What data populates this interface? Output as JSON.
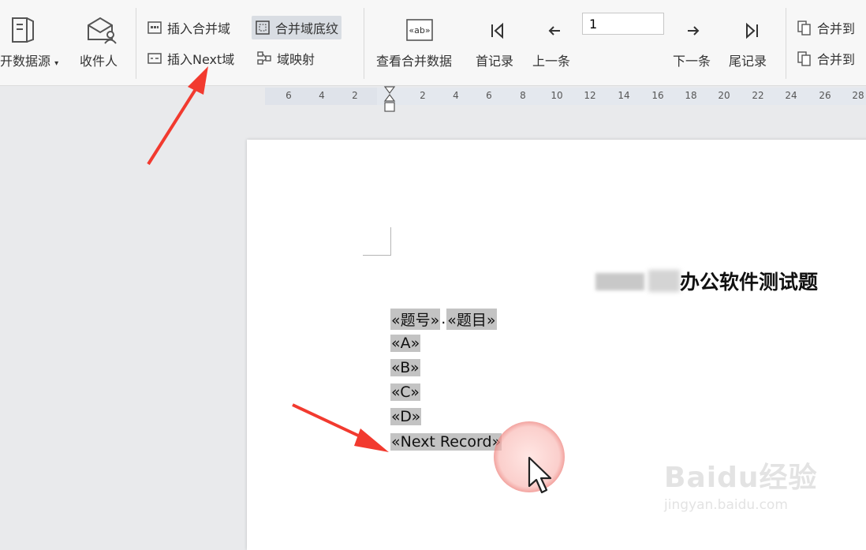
{
  "ribbon": {
    "open_datasource_label": "开数据源",
    "recipients_label": "收件人",
    "insert_merge_field": "插入合并域",
    "merge_field_shading": "合并域底纹",
    "insert_next_field": "插入Next域",
    "field_mapping": "域映射",
    "view_merged_data": "查看合并数据",
    "first_record": "首记录",
    "prev_record": "上一条",
    "record_value": "1",
    "next_record": "下一条",
    "last_record": "尾记录",
    "merge_to_doc_1": "合并到",
    "merge_to_doc_2": "合并到"
  },
  "ruler": {
    "left_ticks": [
      "6",
      "4",
      "2"
    ],
    "right_ticks": [
      "2",
      "4",
      "6",
      "8",
      "10",
      "12",
      "14",
      "16",
      "18",
      "20",
      "22",
      "24",
      "26",
      "28"
    ]
  },
  "document": {
    "title": "办公软件测试题",
    "line1_field1": "«题号»",
    "line1_sep": ".",
    "line1_field2": "«题目»",
    "fields": [
      "«A»",
      "«B»",
      "«C»",
      "«D»",
      "«Next Record»"
    ]
  },
  "watermark": {
    "logo": "Baidu经验",
    "url": "jingyan.baidu.com"
  },
  "colors": {
    "ribbon_bg": "#f7f7f7",
    "field_shading": "#c3c3c3",
    "arrow_red": "#f23a2f",
    "click_ring": "#eb7873"
  }
}
